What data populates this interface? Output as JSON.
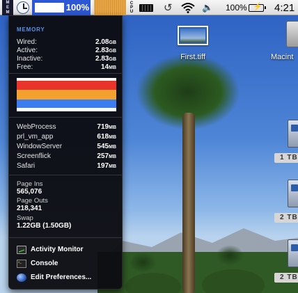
{
  "menubar": {
    "mem_label_lines": [
      "M",
      "E",
      "M"
    ],
    "memory_percent": "100%",
    "cpu_label_lines": [
      "C",
      "P",
      "U"
    ],
    "battery_percent": "100%",
    "clock": "4:21"
  },
  "panel": {
    "header": "MEMORY",
    "memory_stats": [
      {
        "label": "Wired:",
        "value": "2.08",
        "unit": "GB"
      },
      {
        "label": "Active:",
        "value": "2.83",
        "unit": "GB"
      },
      {
        "label": "Inactive:",
        "value": "2.83",
        "unit": "GB"
      },
      {
        "label": "Free:",
        "value": "14",
        "unit": "MB"
      }
    ],
    "graph_colors": [
      "#ffffff",
      "#e8342a",
      "#f2a12e",
      "#3b7df0",
      "#ffffff"
    ],
    "processes": [
      {
        "name": "WebProcess",
        "value": "719",
        "unit": "MB"
      },
      {
        "name": "prl_vm_app",
        "value": "618",
        "unit": "MB"
      },
      {
        "name": "WindowServer",
        "value": "545",
        "unit": "MB"
      },
      {
        "name": "Screenflick",
        "value": "257",
        "unit": "MB"
      },
      {
        "name": "Safari",
        "value": "197",
        "unit": "MB"
      }
    ],
    "page_ins_label": "Page Ins",
    "page_ins_value": "565,076",
    "page_outs_label": "Page Outs",
    "page_outs_value": "218,341",
    "swap_label": "Swap",
    "swap_value": "1.22GB (1.50GB)",
    "menu_items": [
      {
        "label": "Activity Monitor",
        "icon": "activity-monitor-icon"
      },
      {
        "label": "Console",
        "icon": "console-icon"
      },
      {
        "label": "Edit Preferences...",
        "icon": "preferences-icon"
      }
    ]
  },
  "desktop": {
    "file_label": "First.tiff",
    "hd_label": "Macint",
    "drive_badges": [
      "1 TB",
      "2 TB",
      "2 TB"
    ]
  }
}
